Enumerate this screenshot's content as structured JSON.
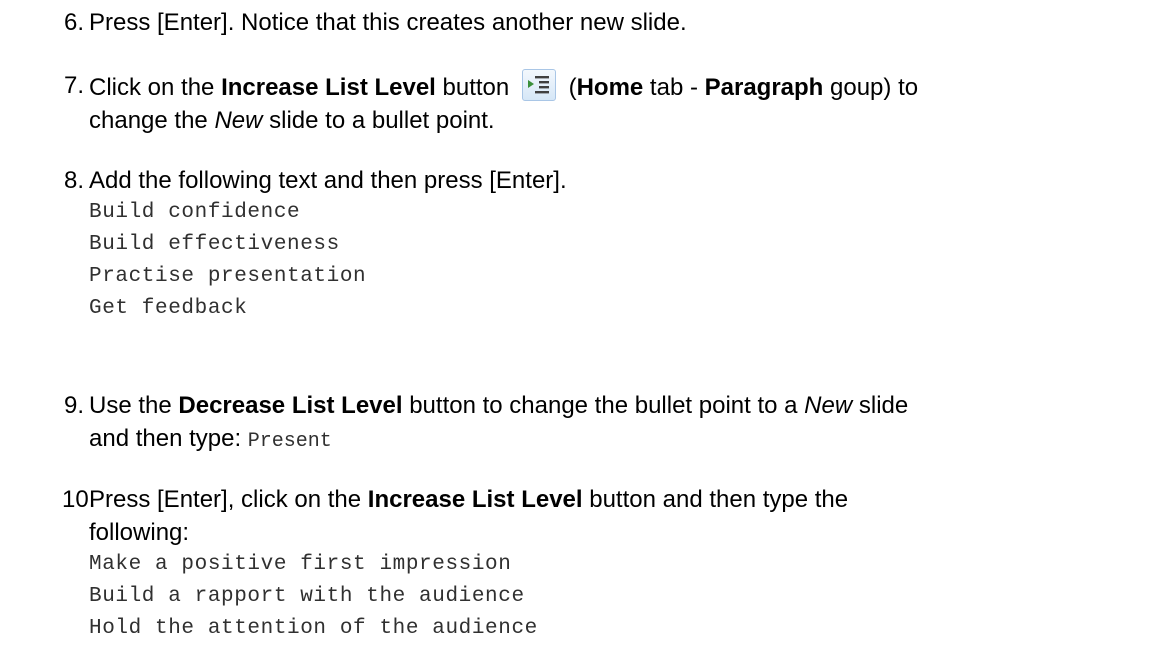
{
  "steps": {
    "s6": {
      "number": "6.",
      "text": "Press [Enter].  Notice that this creates another new slide."
    },
    "s7": {
      "number": "7.",
      "t1": "Click on the ",
      "b1": "Increase List Level",
      "t2": " button ",
      "icon": "increase-list-level-icon",
      "t3": " (",
      "b2": "Home",
      "t4": " tab - ",
      "b3": "Paragraph",
      "t5": " goup) to",
      "line2a": "change the ",
      "i1": "New",
      "line2b": " slide to a bullet point."
    },
    "s8": {
      "number": "8.",
      "text": "Add the following text and then press [Enter].",
      "code": [
        "Build confidence",
        "Build effectiveness",
        "Practise presentation",
        "Get feedback"
      ]
    },
    "s9": {
      "number": "9.",
      "t1": "Use the ",
      "b1": "Decrease List Level",
      "t2": " button to change the bullet point to a ",
      "i1": "New",
      "t3": " slide",
      "line2a": "and then type: ",
      "code_inline": "Present"
    },
    "s10": {
      "number": "10.",
      "t1": "Press [Enter], click on the ",
      "b1": "Increase List Level",
      "t2": " button and then type the",
      "line2": "following:",
      "code": [
        "Make a positive first impression",
        "Build a rapport with the audience",
        "Hold the attention of the audience"
      ]
    }
  },
  "colors": {
    "text": "#000000",
    "code": "#303030",
    "icon_bg": "#d6e7f7",
    "icon_arrow": "#2e7d32"
  }
}
